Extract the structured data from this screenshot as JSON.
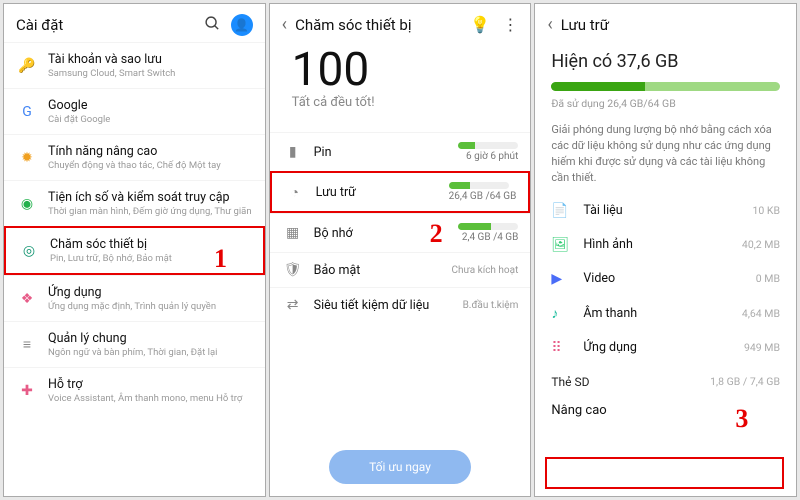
{
  "p1": {
    "title": "Cài đặt",
    "icons": {
      "search": "search-icon",
      "profile": "profile-icon"
    },
    "items": [
      {
        "icon": "🔑",
        "iconName": "key-icon",
        "c": "#1a73e8",
        "t": "Tài khoản và sao lưu",
        "s": "Samsung Cloud, Smart Switch"
      },
      {
        "icon": "G",
        "iconName": "google-icon",
        "c": "#4285f4",
        "t": "Google",
        "s": "Cài đặt Google"
      },
      {
        "icon": "✹",
        "iconName": "feature-icon",
        "c": "#f0a020",
        "t": "Tính năng nâng cao",
        "s": "Chuyển động và thao tác, Chế độ Một tay"
      },
      {
        "icon": "◉",
        "iconName": "wellbeing-icon",
        "c": "#22b14c",
        "t": "Tiện ích số và kiểm soát truy cập",
        "s": "Thời gian màn hình, Đếm giờ ứng dụng, Thư giãn"
      },
      {
        "icon": "◎",
        "iconName": "device-care-icon",
        "c": "#0f936f",
        "t": "Chăm sóc thiết bị",
        "s": "Pin, Lưu trữ, Bộ nhớ, Bảo mật",
        "hl": true
      },
      {
        "icon": "❖",
        "iconName": "apps-icon",
        "c": "#e75c88",
        "t": "Ứng dụng",
        "s": "Ứng dụng mặc định, Trình quản lý quyền"
      },
      {
        "icon": "≡",
        "iconName": "general-icon",
        "c": "#888",
        "t": "Quản lý chung",
        "s": "Ngôn ngữ và bàn phím, Thời gian, Đặt lại"
      },
      {
        "icon": "✚",
        "iconName": "accessibility-icon",
        "c": "#e75c88",
        "t": "Hỗ trợ",
        "s": "Voice Assistant, Âm thanh mono, menu Hỗ trợ"
      }
    ],
    "step": "1"
  },
  "p2": {
    "title": "Chăm sóc thiết bị",
    "score": "100",
    "scoreCap": "Tất cả đều tốt!",
    "items": [
      {
        "icon": "▮",
        "iconName": "battery-icon",
        "t": "Pin",
        "sub": "6 giờ 6 phút",
        "pct": 28
      },
      {
        "icon": "◔",
        "iconName": "storage-icon",
        "t": "Lưu trữ",
        "sub": "26,4 GB /64 GB",
        "pct": 35,
        "hl": true
      },
      {
        "icon": "▦",
        "iconName": "memory-icon",
        "t": "Bộ nhớ",
        "sub": "2,4 GB /4 GB",
        "pct": 55
      },
      {
        "icon": "🛡",
        "iconName": "security-icon",
        "t": "Bảo mật",
        "sub": "Chưa kích hoạt",
        "nobar": true
      },
      {
        "icon": "⇄",
        "iconName": "data-saver-icon",
        "t": "Siêu tiết kiệm dữ liệu",
        "sub": "B.đầu t.kiệm",
        "nobar": true
      }
    ],
    "btn": "Tối ưu ngay",
    "step": "2"
  },
  "p3": {
    "title": "Lưu trữ",
    "avail": "Hiện có 37,6 GB",
    "used": "Đã sử dụng 26,4 GB/64 GB",
    "desc": "Giải phóng dung lượng bộ nhớ bằng cách xóa các dữ liệu không sử dụng như các ứng dụng hiếm khi được sử dụng và các tài liệu không cần thiết.",
    "cats": [
      {
        "icon": "📄",
        "iconName": "document-icon",
        "c": "#f5a623",
        "t": "Tài liệu",
        "v": "10 KB"
      },
      {
        "icon": "🖼",
        "iconName": "image-icon",
        "c": "#2ecc71",
        "t": "Hình ảnh",
        "v": "40,2 MB"
      },
      {
        "icon": "▶",
        "iconName": "video-icon",
        "c": "#4a6cf7",
        "t": "Video",
        "v": "0 MB"
      },
      {
        "icon": "♪",
        "iconName": "audio-icon",
        "c": "#1abc9c",
        "t": "Âm thanh",
        "v": "4,64 MB"
      },
      {
        "icon": "⠿",
        "iconName": "apps-grid-icon",
        "c": "#e75c88",
        "t": "Ứng dụng",
        "v": "949 MB"
      }
    ],
    "sd": {
      "label": "Thẻ SD",
      "v": "1,8 GB / 7,4 GB"
    },
    "adv": "Nâng cao",
    "step": "3"
  }
}
